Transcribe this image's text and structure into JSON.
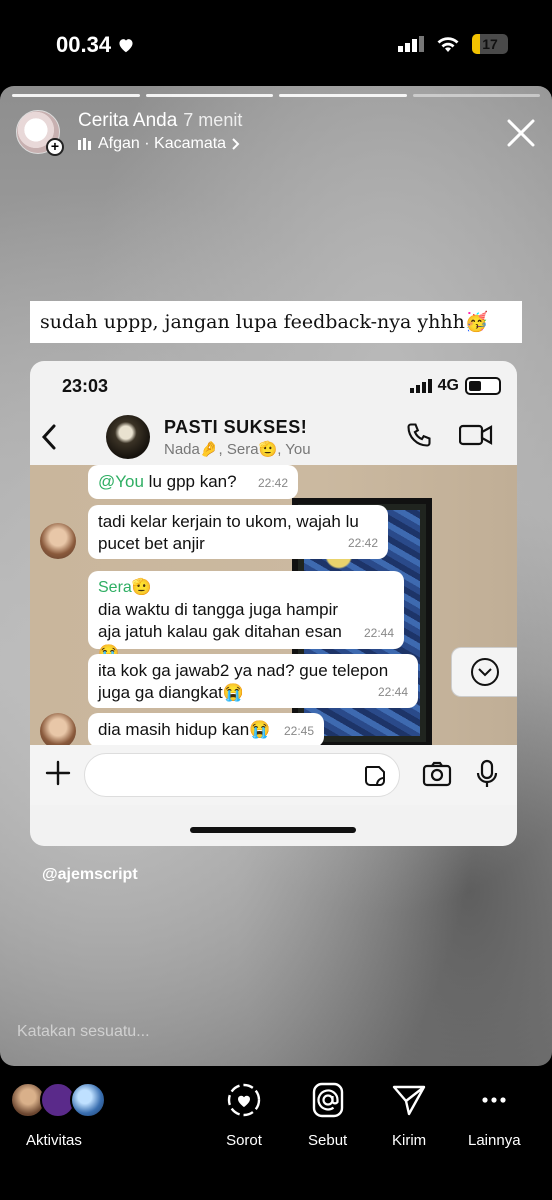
{
  "status_bar": {
    "time": "00.34",
    "battery": "17"
  },
  "story": {
    "user": "Cerita Anda",
    "time_ago": "7 menit",
    "music": "Afgan · Kacamata",
    "caption": "sudah uppp, jangan lupa feedback-nya yhhh🥳",
    "watermark": "@ajemscript",
    "reply_placeholder": "Katakan sesuatu..."
  },
  "chat_screenshot": {
    "time": "23:03",
    "network": "4G",
    "group_name": "PASTI SUKSES!",
    "members": "Nada🤌, Sera🫡, You",
    "messages": [
      {
        "mention": "@You",
        "text": " lu gpp kan?",
        "time": "22:42"
      },
      {
        "text": "tadi kelar kerjain to ukom, wajah lu pucet bet anjir",
        "time": "22:42"
      },
      {
        "sender": "Sera🫡",
        "text": "dia waktu di tangga juga hampir aja jatuh kalau gak ditahan esan😭",
        "time": "22:44"
      },
      {
        "text": "ita kok ga jawab2 ya nad? gue telepon juga ga diangkat😭",
        "time": "22:44"
      },
      {
        "text": "dia masih hidup kan😭",
        "time": "22:45"
      }
    ]
  },
  "bottom_bar": {
    "activity": "Aktivitas",
    "highlight": "Sorot",
    "mention": "Sebut",
    "send": "Kirim",
    "more": "Lainnya"
  }
}
